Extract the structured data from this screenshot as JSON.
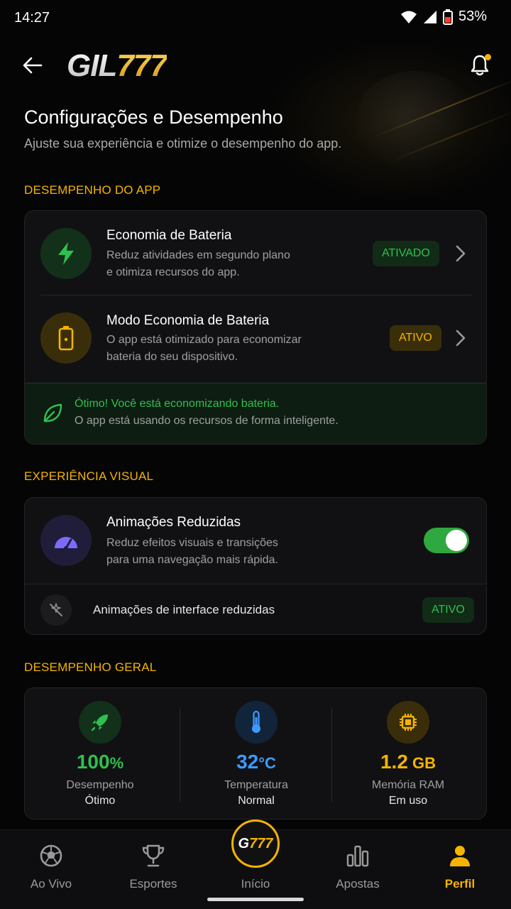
{
  "status_bar": {
    "time": "14:27",
    "battery": "53%"
  },
  "header": {
    "logo_text": "GIL",
    "logo_numbers": "777"
  },
  "page": {
    "title": "Configurações e Desempenho",
    "subtitle": "Ajuste sua experiência e otimize o desempenho do app."
  },
  "performance_section": {
    "title": "DESEMPENHO DO APP",
    "items": [
      {
        "title": "Economia de Bateria",
        "desc_line1": "Reduz atividades em segundo plano",
        "desc_line2": "e otimiza recursos do app.",
        "badge": "ATIVADO",
        "icon": "lightning-icon"
      },
      {
        "title": "Modo Economia de Bateria",
        "desc_line1": "O app está otimizado para economizar",
        "desc_line2": "bateria do seu dispositivo.",
        "badge": "ATIVO",
        "icon": "battery-icon"
      }
    ],
    "tip": {
      "title": "Ótimo! Você está economizando bateria.",
      "desc": "O app está usando os recursos de forma inteligente."
    }
  },
  "visual_section": {
    "title": "EXPERIÊNCIA VISUAL",
    "item": {
      "title": "Animações Reduzidas",
      "desc_line1": "Reduz efeitos visuais e transições",
      "desc_line2": "para uma navegação mais rápida.",
      "toggle_on": true
    },
    "sub_item": {
      "label": "Animações de interface reduzidas",
      "badge": "ATIVO"
    }
  },
  "general_section": {
    "title": "DESEMPENHO GERAL",
    "stats": [
      {
        "value": "100",
        "unit": "%",
        "label": "Desempenho",
        "status": "Ótimo",
        "color": "#2fc04f",
        "icon": "rocket-icon"
      },
      {
        "value": "32",
        "unit": "°C",
        "label": "Temperatura",
        "status": "Normal",
        "color": "#3d9bff",
        "icon": "thermometer-icon"
      },
      {
        "value": "1.2",
        "unit": " GB",
        "label": "Memória RAM",
        "status": "Em uso",
        "color": "#f5b400",
        "icon": "chip-icon"
      }
    ]
  },
  "bottom_nav": {
    "items": [
      {
        "label": "Ao Vivo"
      },
      {
        "label": "Esportes"
      },
      {
        "label": "Início"
      },
      {
        "label": "Apostas"
      },
      {
        "label": "Perfil"
      }
    ],
    "fab_text_a": "G",
    "fab_text_b": "777"
  },
  "colors": {
    "accent": "#f5b400",
    "success": "#2fc04f",
    "info": "#3d9bff",
    "background": "#050505"
  }
}
